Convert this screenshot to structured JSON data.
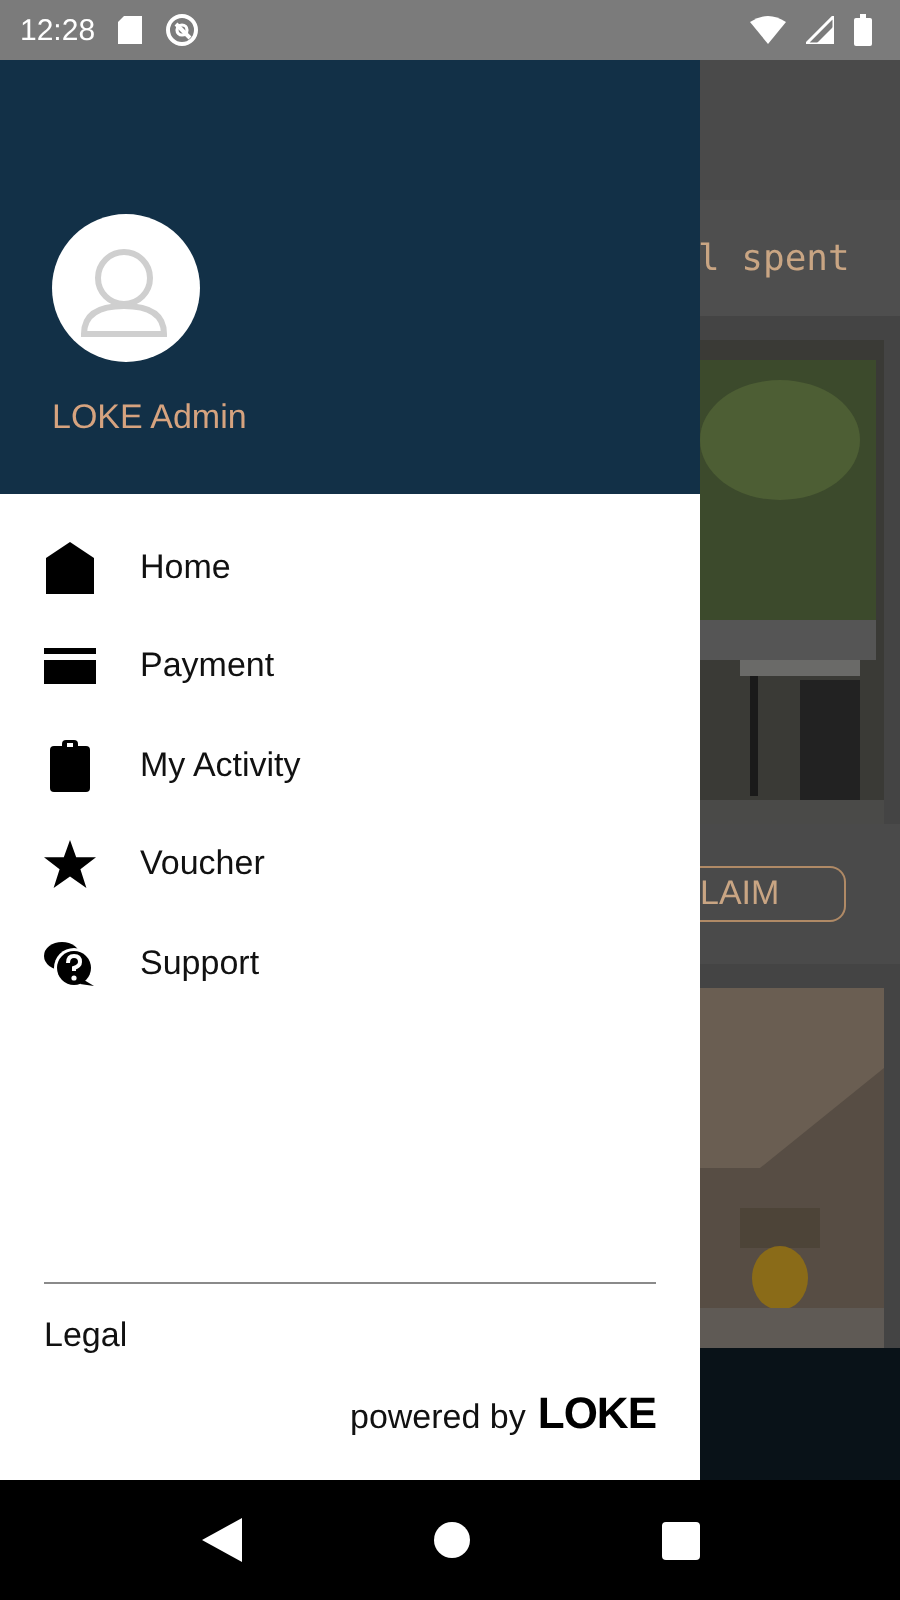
{
  "status_bar": {
    "time": "12:28"
  },
  "drawer": {
    "user_name": "LOKE Admin",
    "items": [
      {
        "label": "Home",
        "kind": "home"
      },
      {
        "label": "Payment",
        "kind": "card"
      },
      {
        "label": "My Activity",
        "kind": "clipboard"
      },
      {
        "label": "Voucher",
        "kind": "star"
      },
      {
        "label": "Support",
        "kind": "support"
      }
    ],
    "footer_link": "Legal",
    "powered_by": "powered by",
    "brand": "LOKE"
  },
  "background": {
    "card_text": "l spent",
    "button": "LAIM"
  }
}
